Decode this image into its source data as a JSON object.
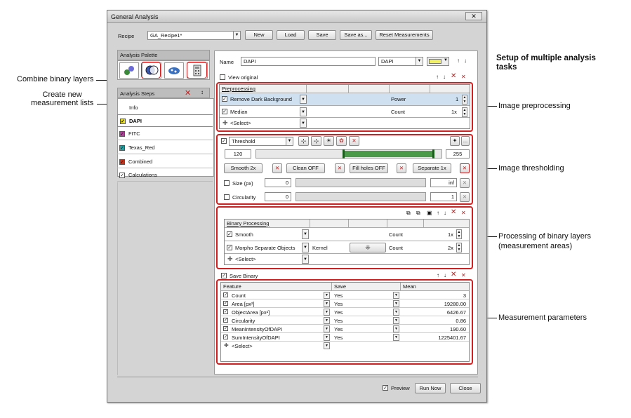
{
  "window": {
    "title": "General Analysis",
    "close": "✕"
  },
  "recipe": {
    "label": "Recipe",
    "value": "GA_Recipe1*",
    "buttons": [
      "New",
      "Load",
      "Save",
      "Save as...",
      "Reset Measurements"
    ]
  },
  "palette": {
    "title": "Analysis Palette"
  },
  "steps": {
    "title": "Analysis Steps",
    "info": "Info",
    "items": [
      {
        "label": "DAPI",
        "color": "#e8e020"
      },
      {
        "label": "FITC",
        "color": "#b0409a"
      },
      {
        "label": "Texas_Red",
        "color": "#20a0a0"
      },
      {
        "label": "Combined",
        "color": "#c83018"
      },
      {
        "label": "Calculations",
        "color": "#ffffff"
      }
    ]
  },
  "name_row": {
    "label": "Name",
    "value": "DAPI",
    "channel": "DAPI",
    "swatch_color": "#f0f060"
  },
  "view_original": "View original",
  "preprocessing": {
    "header": "Preprocessing",
    "rows": [
      {
        "name": "Remove Dark Background",
        "param": "Power",
        "value": "1"
      },
      {
        "name": "Median",
        "param": "Count",
        "value": "1x"
      }
    ],
    "select": "<Select>"
  },
  "threshold": {
    "mode": "Threshold",
    "low": "120",
    "high": "255",
    "low_level": 0.47,
    "high_level": 1.0,
    "buttons": [
      "Smooth 2x",
      "Clean OFF",
      "Fill holes OFF",
      "Separate 1x"
    ],
    "size_label": "Size (px)",
    "size_min": "0",
    "size_max": "inf",
    "circ_label": "Circularity",
    "circ_min": "0",
    "circ_max": "1"
  },
  "binary": {
    "header": "Binary Processing",
    "rows": [
      {
        "name": "Smooth",
        "extra": "",
        "param": "Count",
        "value": "1x"
      },
      {
        "name": "Morpho Separate Objects",
        "extra": "Kernel",
        "param": "Count",
        "value": "2x"
      }
    ],
    "select": "<Select>"
  },
  "save_binary": "Save Binary",
  "measure": {
    "headers": [
      "Feature",
      "Save",
      "Mean"
    ],
    "rows": [
      {
        "feature": "Count",
        "save": "Yes",
        "mean": "3"
      },
      {
        "feature": "Area [px²]",
        "save": "Yes",
        "mean": "19280.00"
      },
      {
        "feature": "ObjectArea [px²]",
        "save": "Yes",
        "mean": "6426.67"
      },
      {
        "feature": "Circularity",
        "save": "Yes",
        "mean": "0.86"
      },
      {
        "feature": "MeanIntensityOfDAPI",
        "save": "Yes",
        "mean": "190.60"
      },
      {
        "feature": "SumIntensityOfDAPI",
        "save": "Yes",
        "mean": "1225401.67"
      }
    ],
    "select": "<Select>"
  },
  "footer": {
    "preview": "Preview",
    "run": "Run Now",
    "close": "Close"
  },
  "annotations": {
    "combine": "Combine binary layers",
    "create": "Create new\nmeasurement lists",
    "setup": "Setup of multiple analysis\ntasks",
    "preproc": "Image preprocessing",
    "thresh": "Image thresholding",
    "binary": "Processing of binary layers\n(measurement areas)",
    "params": "Measurement parameters"
  }
}
